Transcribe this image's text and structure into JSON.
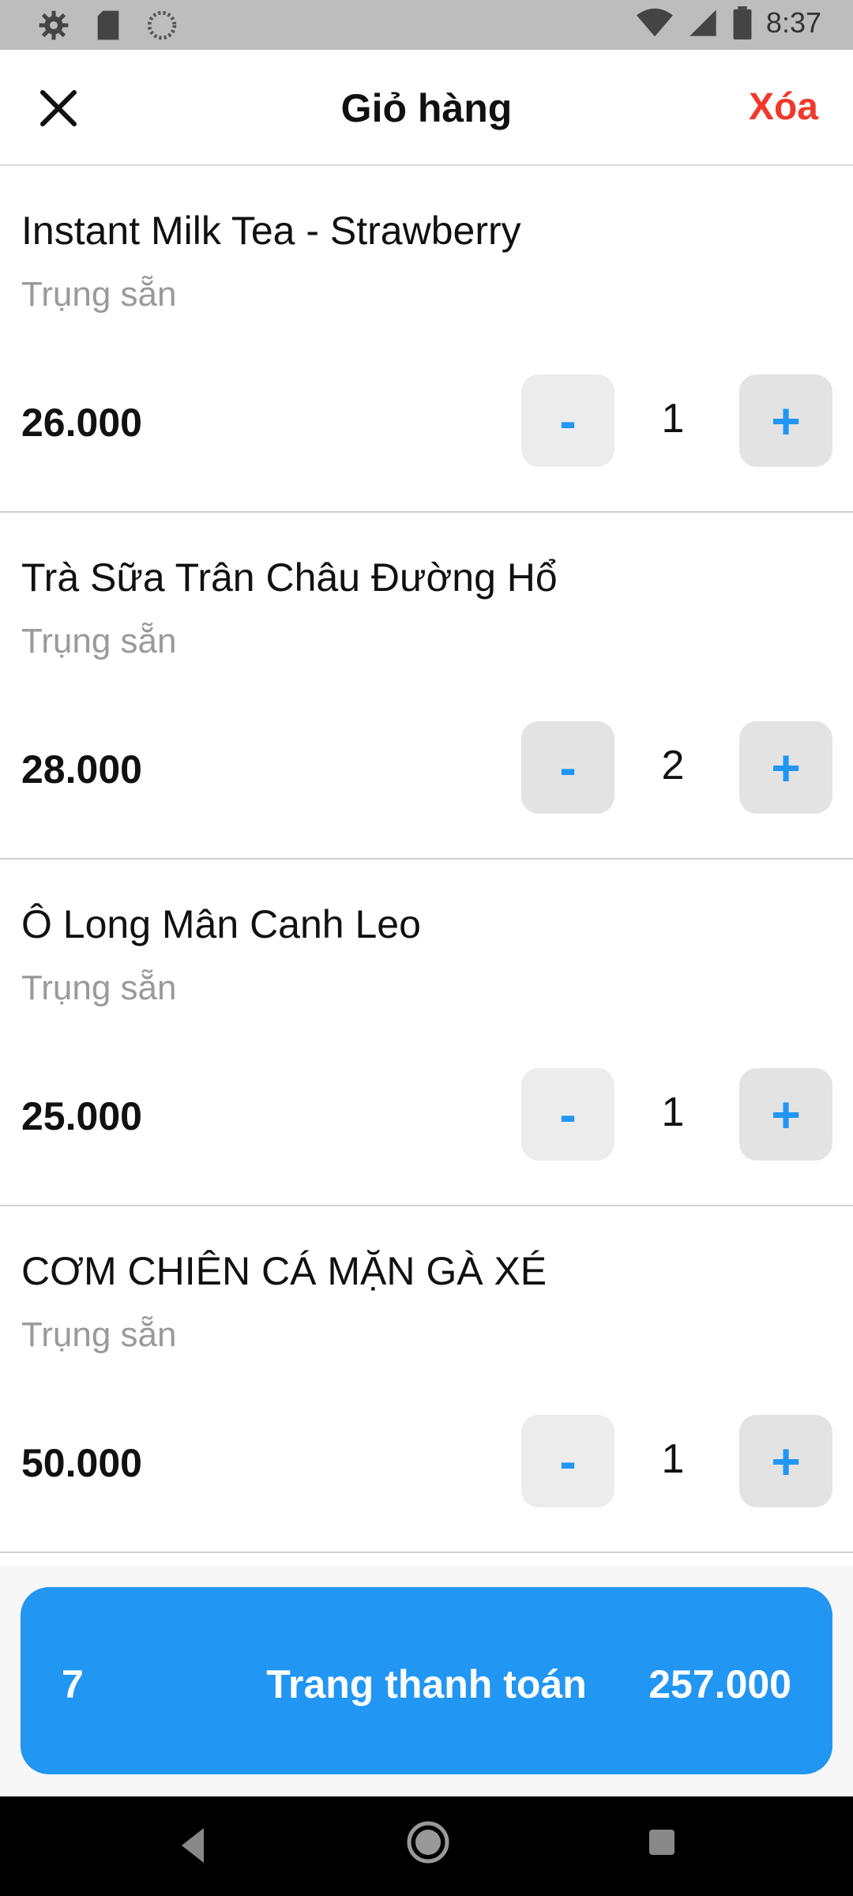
{
  "status_bar": {
    "time": "8:37",
    "left_icons": [
      "settings-icon",
      "sd-card-icon",
      "loading-icon"
    ],
    "right_icons": [
      "wifi-icon",
      "signal-icon",
      "battery-icon"
    ]
  },
  "header": {
    "title": "Giỏ hàng",
    "clear_label": "Xóa",
    "clear_color": "#f0392b"
  },
  "items": [
    {
      "name": "Instant Milk Tea - Strawberry",
      "status": "Trụng sẵn",
      "price": "26.000",
      "qty": "1",
      "minus": "-",
      "plus": "+"
    },
    {
      "name": "Trà Sữa Trân Châu Đường Hổ",
      "status": "Trụng sẵn",
      "price": "28.000",
      "qty": "2",
      "minus": "-",
      "plus": "+"
    },
    {
      "name": "Ô Long Mân Canh Leo",
      "status": "Trụng sẵn",
      "price": "25.000",
      "qty": "1",
      "minus": "-",
      "plus": "+"
    },
    {
      "name": "CƠM CHIÊN CÁ MẶN GÀ XÉ",
      "status": "Trụng sẵn",
      "price": "50.000",
      "qty": "1",
      "minus": "-",
      "plus": "+"
    }
  ],
  "checkout": {
    "count": "7",
    "label": "Trang thanh toán",
    "total": "257.000",
    "color": "#2196f3"
  },
  "nav": {
    "icons": [
      "back-icon",
      "home-icon",
      "recents-icon"
    ]
  }
}
